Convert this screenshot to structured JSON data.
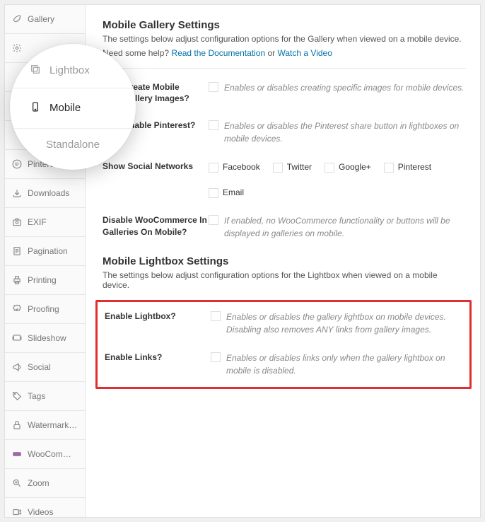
{
  "sidebar": {
    "items": [
      {
        "label": "Gallery",
        "icon": "leaf"
      },
      {
        "label": "",
        "icon": "gear"
      },
      {
        "label": "",
        "icon": ""
      },
      {
        "label": "",
        "icon": ""
      },
      {
        "label": "",
        "icon": ""
      },
      {
        "label": "Pinterest",
        "icon": "pinterest"
      },
      {
        "label": "Downloads",
        "icon": "download"
      },
      {
        "label": "EXIF",
        "icon": "camera"
      },
      {
        "label": "Pagination",
        "icon": "page"
      },
      {
        "label": "Printing",
        "icon": "printer"
      },
      {
        "label": "Proofing",
        "icon": "check-badge"
      },
      {
        "label": "Slideshow",
        "icon": "slides"
      },
      {
        "label": "Social",
        "icon": "megaphone"
      },
      {
        "label": "Tags",
        "icon": "tag"
      },
      {
        "label": "Watermarking",
        "icon": "lock"
      },
      {
        "label": "WooCommerce",
        "icon": "woo"
      },
      {
        "label": "Zoom",
        "icon": "zoom"
      },
      {
        "label": "Videos",
        "icon": "video"
      }
    ]
  },
  "magnifier": {
    "top": "Lightbox",
    "active": "Mobile",
    "bottom": "Standalone"
  },
  "gallery_section": {
    "title": "Mobile Gallery Settings",
    "subtitle": "The settings below adjust configuration options for the Gallery when viewed on a mobile device.",
    "help_prefix": "Need some help? ",
    "doc_link": "Read the Documentation",
    "or": " or ",
    "video_link": "Watch a Video",
    "rows": [
      {
        "label": "Create Mobile Gallery Images?",
        "desc": "Enables or disables creating specific images for mobile devices."
      },
      {
        "label": "Enable Pinterest?",
        "desc": "Enables or disables the Pinterest share button in lightboxes on mobile devices."
      },
      {
        "label": "Show Social Networks",
        "networks": [
          "Facebook",
          "Twitter",
          "Google+",
          "Pinterest",
          "Email"
        ]
      },
      {
        "label": "Disable WooCommerce In Galleries On Mobile?",
        "desc": "If enabled, no WooCommerce functionality or buttons will be displayed in galleries on mobile."
      }
    ]
  },
  "lightbox_section": {
    "title": "Mobile Lightbox Settings",
    "subtitle": "The settings below adjust configuration options for the Lightbox when viewed on a mobile device.",
    "rows": [
      {
        "label": "Enable Lightbox?",
        "desc": "Enables or disables the gallery lightbox on mobile devices. Disabling also removes ANY links from gallery images."
      },
      {
        "label": "Enable Links?",
        "desc": "Enables or disables links only when the gallery lightbox on mobile is disabled."
      }
    ]
  }
}
